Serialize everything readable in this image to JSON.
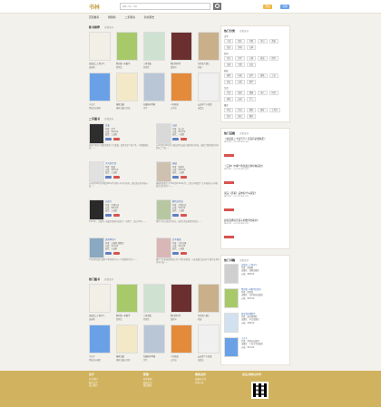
{
  "header": {
    "logo": "书林",
    "search_placeholder": "请输入书名、作者",
    "login": "登录",
    "register": "注册"
  },
  "nav": [
    "首页推荐",
    "畅销榜",
    "二手图书",
    "新书预告"
  ],
  "sections": {
    "new_books": {
      "title": "新书推荐",
      "more": "查看更多"
    },
    "used_books": {
      "title": "二手图书",
      "more": "查看更多"
    },
    "hot_books": {
      "title": "热门图书",
      "more": "查看更多"
    }
  },
  "books_row1": [
    {
      "title": "这就是二十四节气",
      "author": "高春香"
    },
    {
      "title": "我的第一本数学",
      "author": "邱紫纹"
    },
    {
      "title": "三体全集",
      "author": "刘慈欣"
    },
    {
      "title": "我们的时代",
      "author": "梁晓声"
    },
    {
      "title": "月亮和六便士",
      "author": "毛姆"
    }
  ],
  "books_row2": [
    {
      "title": "小王子",
      "author": "圣埃克苏佩里"
    },
    {
      "title": "国家宝藏",
      "author": "国家宝藏节目组"
    },
    {
      "title": "在细雨中呼喊",
      "author": "余华"
    },
    {
      "title": "人间失格",
      "author": "太宰治"
    },
    {
      "title": "云边有个小卖部",
      "author": "张嘉佳"
    }
  ],
  "used_cards": [
    {
      "title": "活着",
      "meta": [
        "作者：余华",
        "价格：¥18.00",
        "成色：九成新"
      ],
      "desc": "讲述了农村人福贵悲惨的人生遭遇。福贵本是个阔少爷，可他嗜赌如命……"
    },
    {
      "title": "边城",
      "meta": [
        "作者：沈从文",
        "价格：¥12.50",
        "成色：八成新"
      ],
      "desc": "以20世纪30年代川湘交界的边城小镇茶峒为背景，描绘了湘西地区特有的风土人情……"
    },
    {
      "title": "平凡的世界",
      "meta": [
        "作者：路遥",
        "价格：¥25.00",
        "成色：九成新"
      ],
      "desc": "以中国70年代中期到80年代中期十年间为背景，通过复杂的矛盾纠葛……"
    },
    {
      "title": "围城",
      "meta": [
        "作者：钱钟书",
        "价格：¥15.00",
        "成色：八成新"
      ],
      "desc": "围城故事发生于1920到1940年代。主角方鸿渐是个从中国南方乡绅家庭走出的青年人……"
    },
    {
      "title": "白夜行",
      "meta": [
        "作者：东野圭吾",
        "价格：¥20.00",
        "成色：九成新"
      ],
      "desc": "1973年，大阪的一栋废弃建筑内发现了一具男尸，此后19年……"
    },
    {
      "title": "解忧杂货店",
      "meta": [
        "作者：东野圭吾",
        "价格：¥16.00",
        "成色：八成新"
      ],
      "desc": "现代人内心流失的东西，这家杂货店能帮你找回……"
    },
    {
      "title": "追风筝的人",
      "meta": [
        "作者：卡勒德·胡赛尼",
        "价格：¥14.00",
        "成色：九成新"
      ],
      "desc": "12岁的阿富汗富家少爷阿米尔与仆人哈桑情同手足……"
    },
    {
      "title": "百年孤独",
      "meta": [
        "作者：马尔克斯",
        "价格：¥22.00",
        "成色：八成新"
      ],
      "desc": "描写了布恩迪亚家族七代人的传奇故事，以及加勒比海沿岸小镇马孔多的百年兴衰……"
    }
  ],
  "sidebar": {
    "categories": {
      "title": "热门分类",
      "more": "查看更多",
      "groups": [
        {
          "name": "文学",
          "tags": [
            "小说",
            "散文",
            "诗歌",
            "传记",
            "青春",
            "纪实",
            "外国",
            "古典"
          ]
        },
        {
          "name": "社科",
          "tags": [
            "历史",
            "哲学",
            "心理",
            "政治",
            "经济",
            "法律",
            "军事",
            "社会"
          ]
        },
        {
          "name": "科技",
          "tags": [
            "编程",
            "科普",
            "医学",
            "建筑",
            "工业",
            "农业",
            "自然",
            "数学"
          ]
        },
        {
          "name": "生活",
          "tags": [
            "烹饪",
            "旅游",
            "健康",
            "育儿",
            "时尚",
            "家居",
            "运动",
            "手工"
          ]
        },
        {
          "name": "教育",
          "tags": [
            "考试",
            "外语",
            "教材",
            "辅导",
            "工具书",
            "童书",
            "励志",
            "教育"
          ]
        }
      ]
    },
    "topics": {
      "title": "热门话题",
      "more": "查看更多",
      "items": [
        {
          "title": "《这就是二十四节气》有没有必要购买？",
          "desc": "来自书友 · 2019年08月26日",
          "tag": "阅读"
        },
        {
          "title": "《三体》中哪个角色最让你印象深刻？",
          "desc": "来自书友 · 2019年08月24日",
          "tag": "阅读"
        },
        {
          "title": "读完《活着》后你有什么感受？",
          "desc": "来自书友 · 2019年08月22日",
          "tag": "阅读"
        },
        {
          "title": "如何选择适合孩子的数学启蒙书？",
          "desc": "来自书友 · 2019年08月20日",
          "tag": "阅读"
        }
      ]
    },
    "hotbooks": {
      "title": "热门书籍",
      "more": "查看更多",
      "items": [
        {
          "title": "这就是二十四节气",
          "lines": [
            "作者：高春香",
            "出版社：海豚出版社",
            "价格：¥88.00"
          ]
        },
        {
          "title": "我的第一本数学启蒙书",
          "lines": [
            "作者：邱紫纹",
            "出版社：北京科技出版社",
            "价格：¥45.00"
          ]
        },
        {
          "title": "故宫里的博物学",
          "lines": [
            "作者：故宫博物院",
            "出版社：中信出版社",
            "价格：¥98.00"
          ]
        },
        {
          "title": "小王子",
          "lines": [
            "作者：圣埃克苏佩里",
            "出版社：人民文学出版社",
            "价格：¥25.00"
          ]
        }
      ]
    }
  },
  "footer": {
    "col1": {
      "h": "关于",
      "links": [
        "关于我们",
        "联系方式",
        "加入我们"
      ]
    },
    "col2": {
      "h": "帮助",
      "links": [
        "新手指南",
        "配送方式",
        "售后服务"
      ]
    },
    "col3": {
      "h": "商务合作",
      "links": [
        "出版社合作",
        "作者入驻"
      ]
    },
    "col4": {
      "h": "关注书林公众号"
    }
  }
}
